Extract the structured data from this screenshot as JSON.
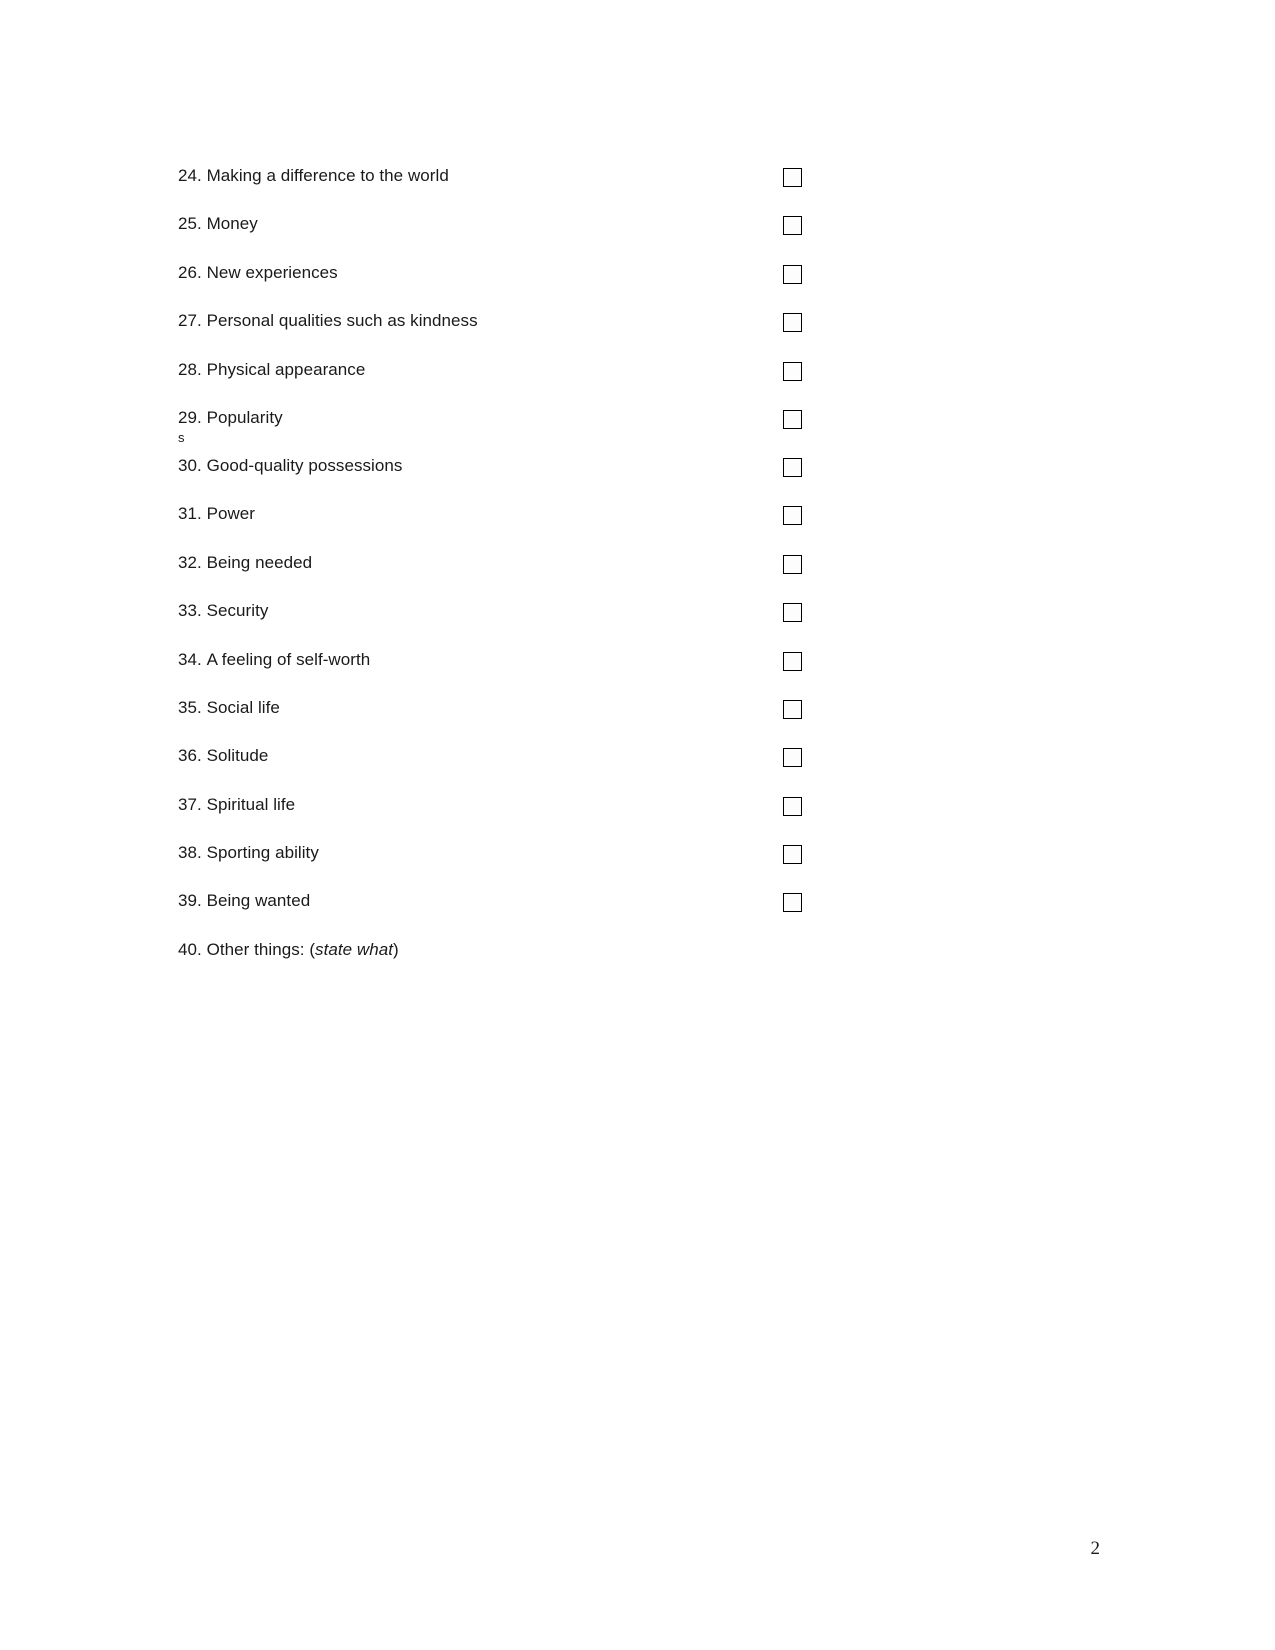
{
  "page": {
    "number_label": "2"
  },
  "questionnaire": {
    "items": [
      {
        "number": "24.",
        "text": "Making a difference to the world",
        "has_checkbox": true,
        "checked": false
      },
      {
        "number": "25.",
        "text": "Money",
        "has_checkbox": true,
        "checked": false
      },
      {
        "number": "26.",
        "text": "New experiences",
        "has_checkbox": true,
        "checked": false
      },
      {
        "number": "27.",
        "text": "Personal qualities such as kindness",
        "has_checkbox": true,
        "checked": false
      },
      {
        "number": "28.",
        "text": "Physical appearance",
        "has_checkbox": true,
        "checked": false
      },
      {
        "number": "29.",
        "text": "Popularity",
        "has_checkbox": true,
        "checked": false
      },
      {
        "number": "30.",
        "text": "Good-quality possessions",
        "has_checkbox": true,
        "checked": false
      },
      {
        "number": "31.",
        "text": "Power",
        "has_checkbox": true,
        "checked": false
      },
      {
        "number": "32.",
        "text": "Being needed",
        "has_checkbox": true,
        "checked": false
      },
      {
        "number": "33.",
        "text": "Security",
        "has_checkbox": true,
        "checked": false
      },
      {
        "number": "34.",
        "text": "A feeling of self-worth",
        "has_checkbox": true,
        "checked": false
      },
      {
        "number": "35.",
        "text": "Social life",
        "has_checkbox": true,
        "checked": false
      },
      {
        "number": "36.",
        "text": "Solitude",
        "has_checkbox": true,
        "checked": false
      },
      {
        "number": "37.",
        "text": "Spiritual life",
        "has_checkbox": true,
        "checked": false
      },
      {
        "number": "38.",
        "text": "Sporting ability",
        "has_checkbox": true,
        "checked": false
      },
      {
        "number": "39.",
        "text": "Being wanted",
        "has_checkbox": true,
        "checked": false
      },
      {
        "number": "40.",
        "text_prefix": "Other things: (",
        "text_italic": "state what",
        "text_suffix": ")",
        "has_checkbox": false
      }
    ],
    "stray_character": "s"
  }
}
